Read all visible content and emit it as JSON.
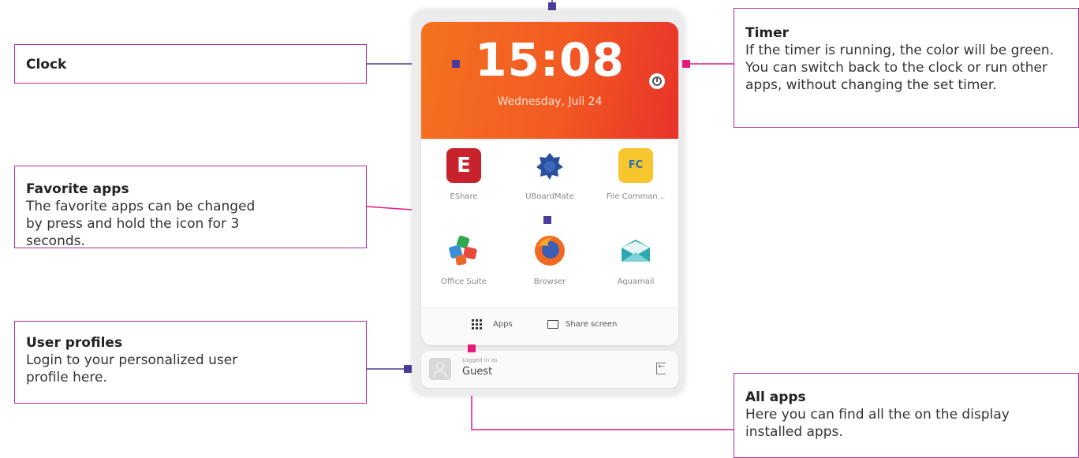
{
  "callouts": {
    "clock": {
      "title": "Clock"
    },
    "favorite": {
      "title": "Favorite apps",
      "desc": "The favorite apps can be changed by press and hold the icon for 3 seconds."
    },
    "user": {
      "title": "User profiles",
      "desc": "Login to your personalized user profile here."
    },
    "timer": {
      "title": "Timer",
      "desc": "If the timer is running, the color will be green. You can switch back to the clock or run other apps, without changing the set timer."
    },
    "all_apps": {
      "title": "All apps",
      "desc": "Here you can find all the on the display installed apps."
    }
  },
  "device": {
    "clock": {
      "time": "15:08",
      "date": "Wednesday, Juli 24"
    },
    "apps": [
      {
        "label": "EShare",
        "icon": "eshare-icon",
        "glyph": "E"
      },
      {
        "label": "UBoardMate",
        "icon": "uboardmate-icon"
      },
      {
        "label": "File Comman...",
        "icon": "file-commander-icon",
        "glyph": "FC"
      },
      {
        "label": "Office Suite",
        "icon": "office-suite-icon"
      },
      {
        "label": "Browser",
        "icon": "browser-icon"
      },
      {
        "label": "Aquamail",
        "icon": "aquamail-icon"
      }
    ],
    "bottom_bar": {
      "apps_label": "Apps",
      "share_label": "Share screen"
    },
    "user": {
      "logged_in_as": "Logged in as",
      "name": "Guest"
    }
  },
  "colors": {
    "callout_border": "#b0308f",
    "marker_purple": "#4b3a9a",
    "marker_pink": "#e6197f",
    "clock_gradient_start": "#f47120",
    "clock_gradient_end": "#e8322a"
  }
}
